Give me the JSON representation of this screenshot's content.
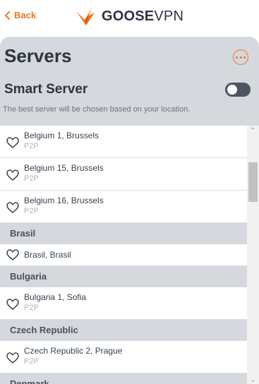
{
  "topbar": {
    "back_label": "Back",
    "logo_text_bold": "GOOSE",
    "logo_text_light": "VPN",
    "logo_icon": "goose-icon"
  },
  "panel": {
    "title": "Servers",
    "more_icon": "more-icon",
    "smart_server_label": "Smart Server",
    "smart_server_enabled": false,
    "smart_server_description": "The best server will be chosen based on your location."
  },
  "list": {
    "items": [
      {
        "kind": "server",
        "name": "Belgium 1, Brussels",
        "tag": "P2P"
      },
      {
        "kind": "server",
        "name": "Belgium 15, Brussels",
        "tag": "P2P"
      },
      {
        "kind": "server",
        "name": "Belgium 16, Brussels",
        "tag": "P2P"
      },
      {
        "kind": "header",
        "name": "Brasil"
      },
      {
        "kind": "server",
        "name": "Brasil, Brasil",
        "tag": ""
      },
      {
        "kind": "header",
        "name": "Bulgaria"
      },
      {
        "kind": "server",
        "name": "Bulgaria 1, Sofia",
        "tag": "P2P"
      },
      {
        "kind": "header",
        "name": "Czech Republic"
      },
      {
        "kind": "server",
        "name": "Czech Republic 2, Prague",
        "tag": "P2P"
      },
      {
        "kind": "header",
        "name": "Denmark"
      }
    ]
  },
  "colors": {
    "accent": "#f2731f",
    "panel_bg": "#d5d8dd",
    "text_dark": "#2b3440"
  }
}
